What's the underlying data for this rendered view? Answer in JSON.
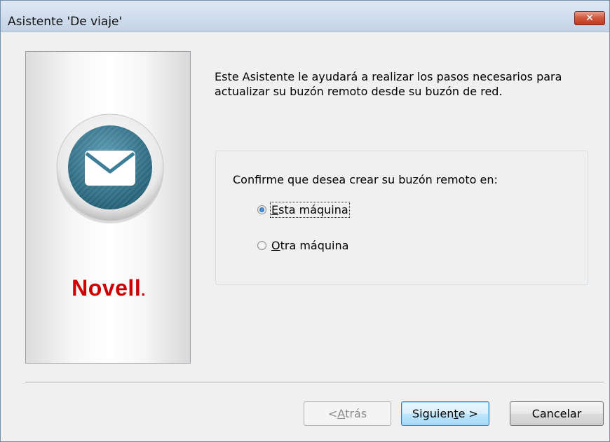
{
  "window": {
    "title": "Asistente 'De viaje'",
    "close_label": "✕"
  },
  "side_panel": {
    "icon": "mail-envelope-icon",
    "brand": "Novell",
    "brand_dot": "."
  },
  "main": {
    "intro_text": "Este Asistente le ayudará a realizar los pasos necesarios para actualizar su buzón remoto desde su buzón de red.",
    "prompt": "Confirme que desea crear su buzón remoto en:",
    "options": [
      {
        "hotkey": "E",
        "rest": "sta máquina",
        "selected": true
      },
      {
        "hotkey": "O",
        "rest": "tra máquina",
        "selected": false
      }
    ]
  },
  "buttons": {
    "back": {
      "prefix": "< ",
      "hotkey": "A",
      "rest": "trás",
      "enabled": false
    },
    "next": {
      "prefix": "Siguien",
      "hotkey": "t",
      "rest": "e >",
      "default": true
    },
    "cancel": {
      "label": "Cancelar"
    }
  },
  "colors": {
    "brand_red": "#cc0000",
    "icon_teal": "#2f6f86",
    "default_button_border": "#3c7fb1"
  }
}
